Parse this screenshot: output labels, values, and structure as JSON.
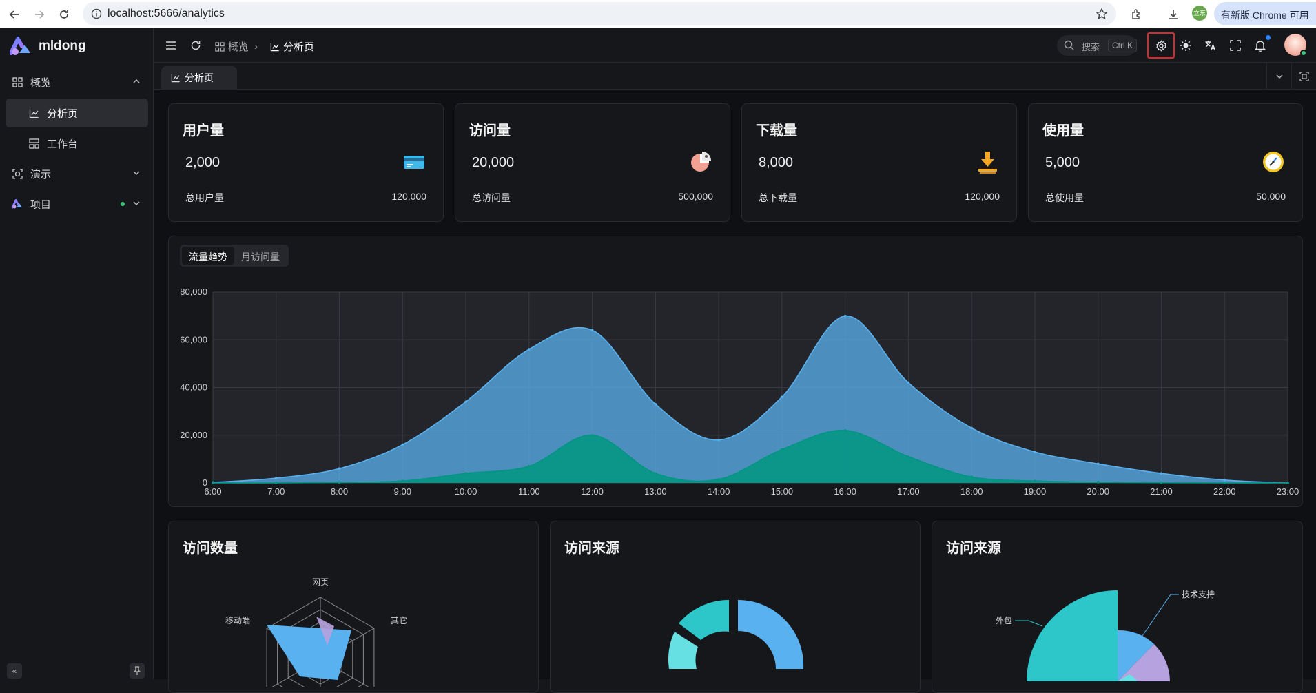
{
  "browser": {
    "url": "localhost:5666/analytics",
    "update_label": "有新版 Chrome 可用",
    "ext_badge": "立东"
  },
  "app": {
    "logo_text": "mldong"
  },
  "sidebar": {
    "items": [
      {
        "label": "概览",
        "icon": "dashboard-icon",
        "expanded": true
      },
      {
        "label": "分析页",
        "icon": "chart-icon",
        "active": true
      },
      {
        "label": "工作台",
        "icon": "workspace-icon"
      },
      {
        "label": "演示",
        "icon": "demo-icon"
      },
      {
        "label": "项目",
        "icon": "project-logo-icon"
      }
    ]
  },
  "header": {
    "breadcrumb": [
      "概览",
      "分析页"
    ],
    "search_placeholder": "搜索",
    "search_shortcut": "Ctrl K"
  },
  "tabs": [
    {
      "label": "分析页",
      "icon": "chart-icon",
      "active": true
    }
  ],
  "stats": [
    {
      "title": "用户量",
      "value": "2,000",
      "foot_label": "总用户量",
      "foot_value": "120,000",
      "icon": "card-icon"
    },
    {
      "title": "访问量",
      "value": "20,000",
      "foot_label": "总访问量",
      "foot_value": "500,000",
      "icon": "pie-icon"
    },
    {
      "title": "下载量",
      "value": "8,000",
      "foot_label": "总下载量",
      "foot_value": "120,000",
      "icon": "download-icon"
    },
    {
      "title": "使用量",
      "value": "5,000",
      "foot_label": "总使用量",
      "foot_value": "50,000",
      "icon": "clock-icon"
    }
  ],
  "trend_tabs": [
    "流量趋势",
    "月访问量"
  ],
  "panels": {
    "visits_count": "访问数量",
    "visit_source_1": "访问来源",
    "visit_source_2": "访问来源"
  },
  "colors": {
    "series_a": "#5ab1ef",
    "series_b": "#019680",
    "accent_red": "#e0262b"
  },
  "chart_data": [
    {
      "type": "area",
      "x": [
        "6:00",
        "7:00",
        "8:00",
        "9:00",
        "10:00",
        "11:00",
        "12:00",
        "13:00",
        "14:00",
        "15:00",
        "16:00",
        "17:00",
        "18:00",
        "19:00",
        "20:00",
        "21:00",
        "22:00",
        "23:00"
      ],
      "series": [
        {
          "values": [
            200,
            2000,
            6000,
            16000,
            34000,
            56000,
            64000,
            33000,
            18000,
            36000,
            70000,
            42000,
            23000,
            13000,
            8000,
            4000,
            1200,
            0
          ]
        },
        {
          "values": [
            0,
            0,
            200,
            800,
            4000,
            7000,
            20000,
            4000,
            1500,
            14000,
            22000,
            11000,
            2500,
            800,
            300,
            100,
            0,
            0
          ]
        }
      ],
      "ylim": [
        0,
        80000
      ],
      "yticks": [
        "0",
        "20,000",
        "40,000",
        "60,000",
        "80,000"
      ],
      "grid": true
    },
    {
      "type": "radar",
      "indicators": [
        "网页",
        "其它",
        "移动端"
      ]
    },
    {
      "type": "pie",
      "labels": [
        "外包",
        "技术支持"
      ]
    }
  ]
}
